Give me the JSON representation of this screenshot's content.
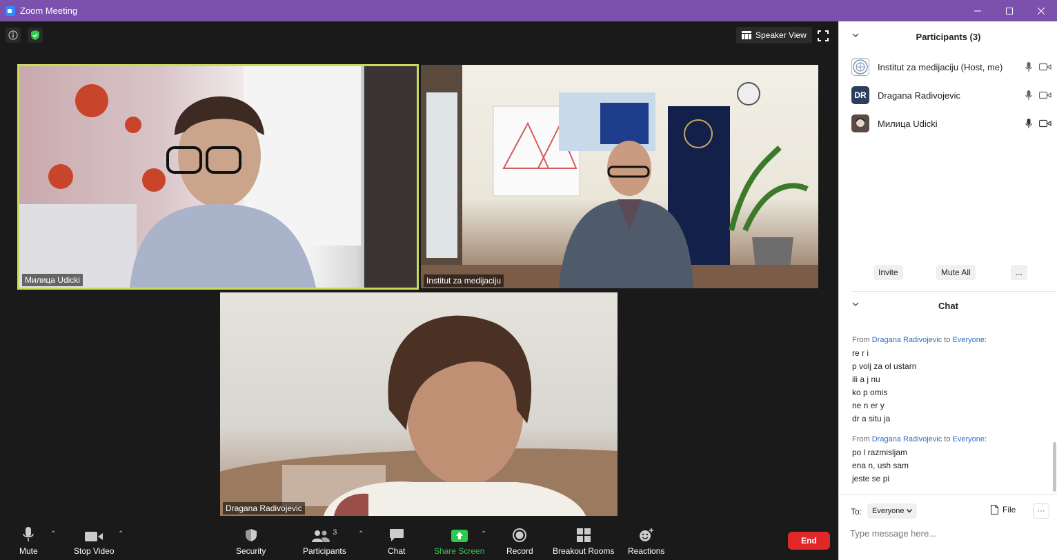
{
  "window": {
    "title": "Zoom Meeting"
  },
  "top": {
    "view_label": "Speaker View"
  },
  "videos": [
    {
      "name": "Милица Udicki"
    },
    {
      "name": "Institut za medijaciju"
    },
    {
      "name": "Dragana Radivojevic"
    }
  ],
  "toolbar": {
    "mute": "Mute",
    "stop_video": "Stop Video",
    "security": "Security",
    "participants": "Participants",
    "participants_count": "3",
    "chat": "Chat",
    "share_screen": "Share Screen",
    "record": "Record",
    "breakout_rooms": "Breakout Rooms",
    "reactions": "Reactions",
    "end": "End"
  },
  "participants_panel": {
    "title": "Participants (3)",
    "items": [
      {
        "name": "Institut za medijaciju (Host, me)",
        "avatar": ""
      },
      {
        "name": "Dragana Radivojevic",
        "avatar": "DR"
      },
      {
        "name": "Милица Udicki",
        "avatar": ""
      }
    ],
    "invite": "Invite",
    "mute_all": "Mute All",
    "more": "..."
  },
  "chat_panel": {
    "title": "Chat",
    "messages": [
      {
        "from": "Dragana Radivojevic",
        "to": "Everyone",
        "lines": [
          "re  r i",
          "p  volj  za ol    ustarn",
          "ili  a j  nu",
          "ko  p  omis",
          "ne  n   er  y",
          "dr   a situ  ja"
        ]
      },
      {
        "from": "Dragana Radivojevic",
        "to": "Everyone",
        "lines": [
          "po  l         razmisljam",
          "        ena  n, ush              sam",
          "jeste se pi"
        ]
      }
    ],
    "from_word": "From",
    "to_word": "to",
    "to_label": "To:",
    "to_value": "Everyone",
    "file_label": "File",
    "more_label": "···",
    "placeholder": "Type message here..."
  },
  "colors": {
    "title_bar": "#7b51ad",
    "active_speaker_border": "#c9dc5a",
    "end_button": "#e02828",
    "share_green": "#2ec94d",
    "link_blue": "#2d6bc9"
  }
}
